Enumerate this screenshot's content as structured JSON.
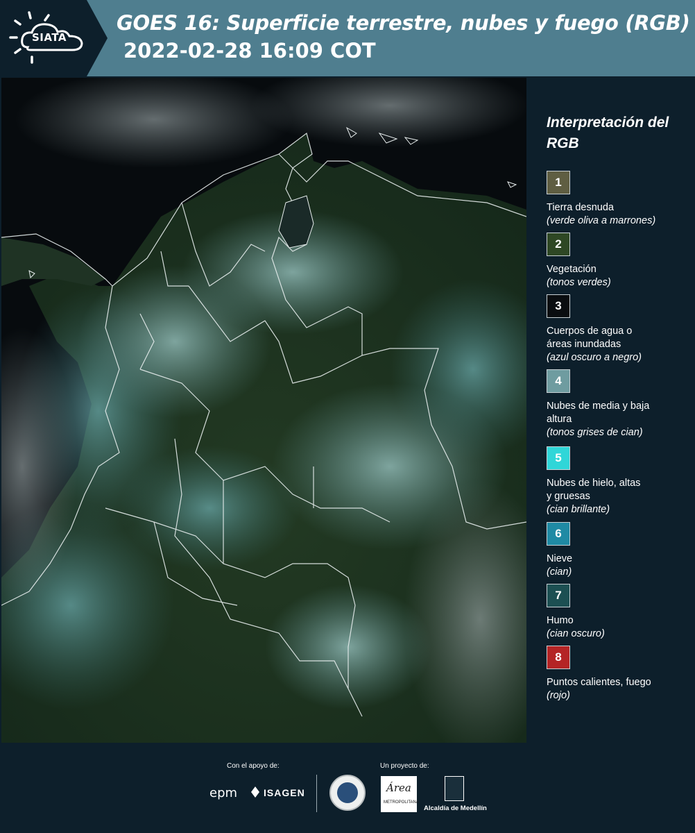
{
  "header": {
    "logo_text": "SIATA",
    "title": "GOES 16: Superficie terrestre, nubes y fuego (RGB)",
    "subtitle": "2022-02-28 16:09 COT"
  },
  "legend": {
    "title": "Interpretación del RGB",
    "items": [
      {
        "number": "1",
        "label": "Tierra desnuda",
        "note": "(verde oliva a marrones)",
        "color": "#5f5e42"
      },
      {
        "number": "2",
        "label": "Vegetación",
        "note": "(tonos verdes)",
        "color": "#2e4724"
      },
      {
        "number": "3",
        "label": "Cuerpos de agua o áreas inundadas",
        "note": "(azul oscuro a negro)",
        "color": "#0a0d10"
      },
      {
        "number": "4",
        "label": "Nubes de media y baja altura",
        "note": "(tonos grises de cian)",
        "color": "#6f9ca0"
      },
      {
        "number": "5",
        "label": "Nubes de hielo, altas y gruesas",
        "note": "(cian brillante)",
        "color": "#2fd6d8"
      },
      {
        "number": "6",
        "label": "Nieve",
        "note": "(cian)",
        "color": "#1f8aa4"
      },
      {
        "number": "7",
        "label": "Humo",
        "note": "(cian oscuro)",
        "color": "#1c4f52"
      },
      {
        "number": "8",
        "label": "Puntos calientes, fuego",
        "note": "(rojo)",
        "color": "#b42425"
      }
    ]
  },
  "footer": {
    "support_label": "Con el apoyo de:",
    "project_label": "Un proyecto de:",
    "sponsor_1": "epm",
    "sponsor_2": "ISAGEN",
    "partner_area": "Área",
    "partner_area_sub": "METROPOLITANA",
    "partner_alcaldia": "Alcaldía de Medellín"
  },
  "colors": {
    "header_bg": "#4f7e8f",
    "logo_panel_bg": "#0d1f2b",
    "page_bg": "#0d1f2b"
  }
}
